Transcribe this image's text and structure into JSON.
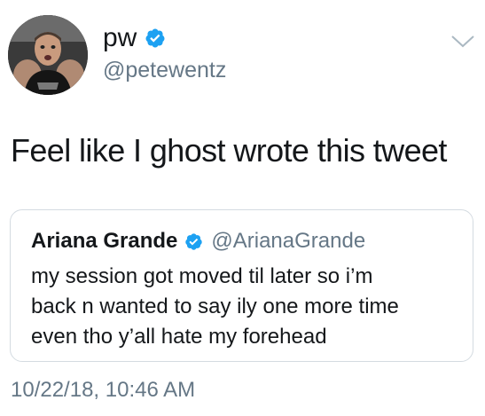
{
  "author": {
    "display_name": "pw",
    "handle": "@petewentz",
    "verified": true,
    "avatar_icon": "profile-photo"
  },
  "tweet": {
    "text": "Feel like I ghost wrote this tweet",
    "timestamp": "10/22/18, 10:46 AM"
  },
  "quoted_tweet": {
    "display_name": "Ariana Grande",
    "handle": "@ArianaGrande",
    "verified": true,
    "text_lines": [
      "my session got moved til later so i’m",
      "back n wanted to say ily one more time",
      "even tho y’all hate my forehead"
    ]
  },
  "colors": {
    "verified_badge": "#1da1f2",
    "secondary_text": "#657786",
    "primary_text": "#14171a",
    "border": "#d4dbe1"
  }
}
